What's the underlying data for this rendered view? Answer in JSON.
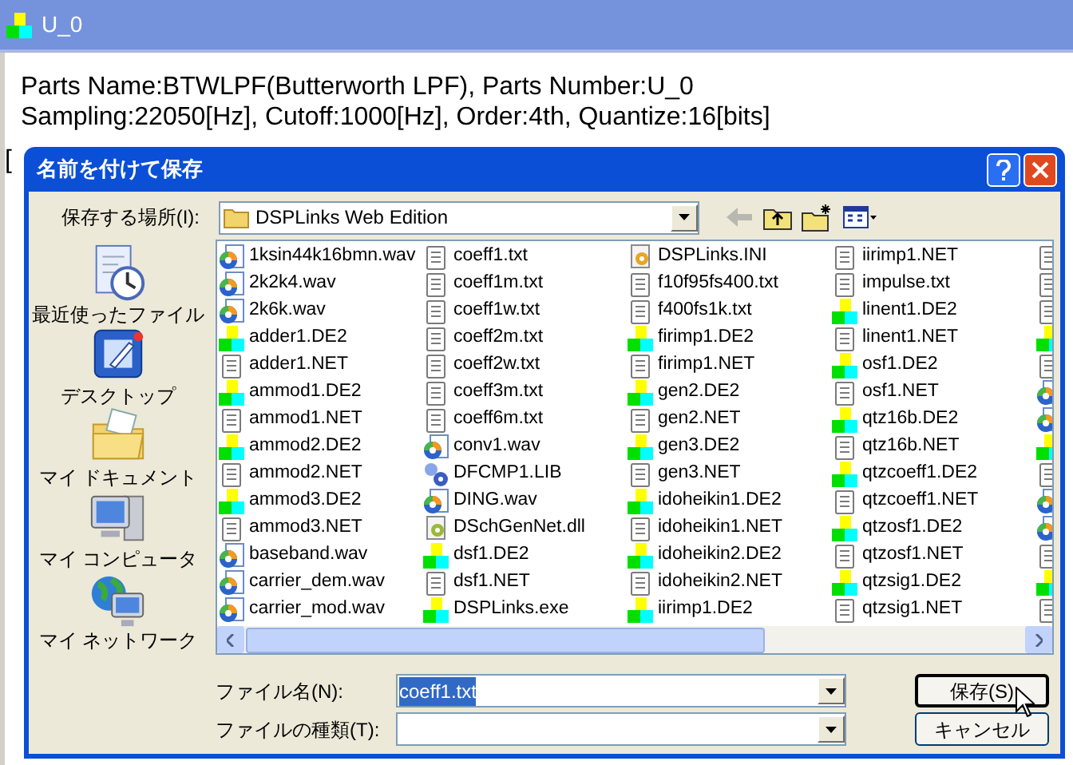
{
  "window": {
    "title": "U_0",
    "lines": [
      "Parts Name:BTWLPF(Butterworth LPF), Parts Number:U_0",
      "Sampling:22050[Hz], Cutoff:1000[Hz], Order:4th, Quantize:16[bits]"
    ],
    "partial_text": "["
  },
  "dialog": {
    "title": "名前を付けて保存",
    "location_label": "保存する場所(I):",
    "location": "DSPLinks Web Edition",
    "places": [
      {
        "kind": "recent",
        "label": "最近使ったファイル"
      },
      {
        "kind": "desktop",
        "label": "デスクトップ"
      },
      {
        "kind": "documents",
        "label": "マイ ドキュメント"
      },
      {
        "kind": "computer",
        "label": "マイ コンピュータ"
      },
      {
        "kind": "network",
        "label": "マイ ネットワーク"
      }
    ],
    "file_columns": [
      [
        {
          "name": "1ksin44k16bmn.wav",
          "kind": "wav"
        },
        {
          "name": "2k2k4.wav",
          "kind": "wav"
        },
        {
          "name": "2k6k.wav",
          "kind": "wav"
        },
        {
          "name": "adder1.DE2",
          "kind": "dsp"
        },
        {
          "name": "adder1.NET",
          "kind": "txt"
        },
        {
          "name": "ammod1.DE2",
          "kind": "dsp"
        },
        {
          "name": "ammod1.NET",
          "kind": "txt"
        },
        {
          "name": "ammod2.DE2",
          "kind": "dsp"
        },
        {
          "name": "ammod2.NET",
          "kind": "txt"
        },
        {
          "name": "ammod3.DE2",
          "kind": "dsp"
        },
        {
          "name": "ammod3.NET",
          "kind": "txt"
        },
        {
          "name": "baseband.wav",
          "kind": "wav"
        },
        {
          "name": "carrier_dem.wav",
          "kind": "wav"
        },
        {
          "name": "carrier_mod.wav",
          "kind": "wav"
        }
      ],
      [
        {
          "name": "coeff1.txt",
          "kind": "txt"
        },
        {
          "name": "coeff1m.txt",
          "kind": "txt"
        },
        {
          "name": "coeff1w.txt",
          "kind": "txt"
        },
        {
          "name": "coeff2m.txt",
          "kind": "txt"
        },
        {
          "name": "coeff2w.txt",
          "kind": "txt"
        },
        {
          "name": "coeff3m.txt",
          "kind": "txt"
        },
        {
          "name": "coeff6m.txt",
          "kind": "txt"
        },
        {
          "name": "conv1.wav",
          "kind": "wav"
        },
        {
          "name": "DFCMP1.LIB",
          "kind": "lib"
        },
        {
          "name": "DING.wav",
          "kind": "wav"
        },
        {
          "name": "DSchGenNet.dll",
          "kind": "dll"
        },
        {
          "name": "dsf1.DE2",
          "kind": "dsp"
        },
        {
          "name": "dsf1.NET",
          "kind": "txt"
        },
        {
          "name": "DSPLinks.exe",
          "kind": "dsp"
        }
      ],
      [
        {
          "name": "DSPLinks.INI",
          "kind": "ini"
        },
        {
          "name": "f10f95fs400.txt",
          "kind": "txt"
        },
        {
          "name": "f400fs1k.txt",
          "kind": "txt"
        },
        {
          "name": "firimp1.DE2",
          "kind": "dsp"
        },
        {
          "name": "firimp1.NET",
          "kind": "txt"
        },
        {
          "name": "gen2.DE2",
          "kind": "dsp"
        },
        {
          "name": "gen2.NET",
          "kind": "txt"
        },
        {
          "name": "gen3.DE2",
          "kind": "dsp"
        },
        {
          "name": "gen3.NET",
          "kind": "txt"
        },
        {
          "name": "idoheikin1.DE2",
          "kind": "dsp"
        },
        {
          "name": "idoheikin1.NET",
          "kind": "txt"
        },
        {
          "name": "idoheikin2.DE2",
          "kind": "dsp"
        },
        {
          "name": "idoheikin2.NET",
          "kind": "txt"
        },
        {
          "name": "iirimp1.DE2",
          "kind": "dsp"
        }
      ],
      [
        {
          "name": "iirimp1.NET",
          "kind": "txt"
        },
        {
          "name": "impulse.txt",
          "kind": "txt"
        },
        {
          "name": "linent1.DE2",
          "kind": "dsp"
        },
        {
          "name": "linent1.NET",
          "kind": "txt"
        },
        {
          "name": "osf1.DE2",
          "kind": "dsp"
        },
        {
          "name": "osf1.NET",
          "kind": "txt"
        },
        {
          "name": "qtz16b.DE2",
          "kind": "dsp"
        },
        {
          "name": "qtz16b.NET",
          "kind": "txt"
        },
        {
          "name": "qtzcoeff1.DE2",
          "kind": "dsp"
        },
        {
          "name": "qtzcoeff1.NET",
          "kind": "txt"
        },
        {
          "name": "qtzosf1.DE2",
          "kind": "dsp"
        },
        {
          "name": "qtzosf1.NET",
          "kind": "txt"
        },
        {
          "name": "qtzsig1.DE2",
          "kind": "dsp"
        },
        {
          "name": "qtzsig1.NET",
          "kind": "txt"
        }
      ],
      [
        {
          "kind": "txt"
        },
        {
          "kind": "txt"
        },
        {
          "kind": "txt"
        },
        {
          "kind": "dsp"
        },
        {
          "kind": "txt"
        },
        {
          "kind": "wav"
        },
        {
          "kind": "wav"
        },
        {
          "kind": "dsp"
        },
        {
          "kind": "txt"
        },
        {
          "kind": "wav"
        },
        {
          "kind": "wav"
        },
        {
          "kind": "txt"
        },
        {
          "kind": "dsp"
        },
        {
          "kind": "txt"
        }
      ]
    ],
    "filename_label": "ファイル名(N):",
    "filename": {
      "value": "coeff1.txt",
      "selected": true
    },
    "filetype_label": "ファイルの種類(T):",
    "buttons": [
      {
        "label": "保存(S)",
        "default": true
      },
      {
        "label": "キャンセル",
        "default": false
      }
    ]
  }
}
